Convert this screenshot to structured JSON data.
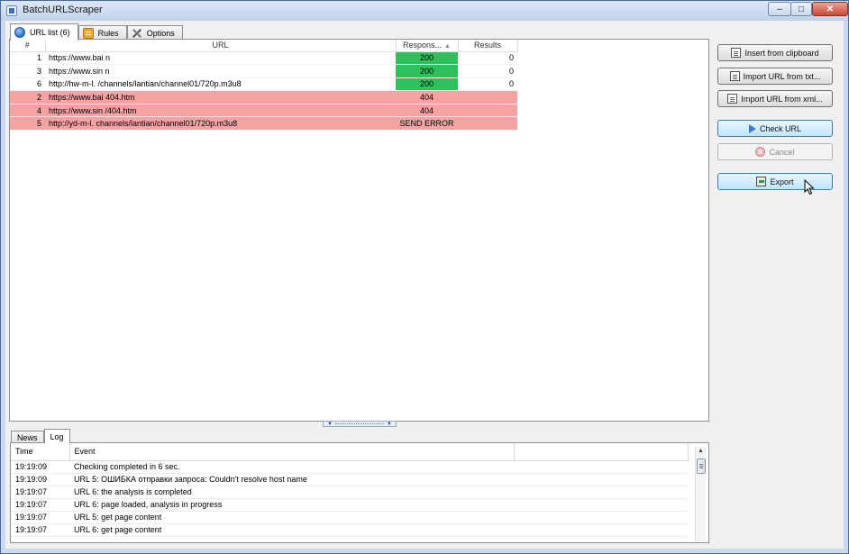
{
  "window": {
    "title": "BatchURLScraper"
  },
  "tabs_top": [
    {
      "label": "URL list (6)",
      "icon": "globe-icon",
      "active": true
    },
    {
      "label": "Rules",
      "icon": "rules-icon",
      "active": false
    },
    {
      "label": "Options",
      "icon": "tools-icon",
      "active": false
    }
  ],
  "url_table": {
    "columns": {
      "num": "#",
      "url": "URL",
      "response": "Respons...",
      "results": "Results"
    },
    "rows": [
      {
        "num": "1",
        "url": "https://www.bai          n",
        "response": "200",
        "results": "0",
        "status": "ok"
      },
      {
        "num": "3",
        "url": "https://www.sin          n",
        "response": "200",
        "results": "0",
        "status": "ok"
      },
      {
        "num": "6",
        "url": "http://hw-m-l.          /channels/lantian/channel01/720p.m3u8",
        "response": "200",
        "results": "0",
        "status": "ok"
      },
      {
        "num": "2",
        "url": "https://www.bai          404.htm",
        "response": "404",
        "results": "",
        "status": "err"
      },
      {
        "num": "4",
        "url": "https://www.sin          /404.htm",
        "response": "404",
        "results": "",
        "status": "err"
      },
      {
        "num": "5",
        "url": "http://yd-m-l.          channels/lantian/channel01/720p.m3u8",
        "response": "SEND ERROR",
        "results": "",
        "status": "err"
      }
    ]
  },
  "tabs_bottom": [
    {
      "label": "News",
      "active": false
    },
    {
      "label": "Log",
      "active": true
    }
  ],
  "log_table": {
    "columns": {
      "time": "Time",
      "event": "Event"
    },
    "rows": [
      {
        "time": "19:19:09",
        "event": "Checking completed in 6 sec."
      },
      {
        "time": "19:19:09",
        "event": "URL 5: ОШИБКА отправки запроса: Couldn't resolve host name"
      },
      {
        "time": "19:19:07",
        "event": "URL 6: the analysis is completed"
      },
      {
        "time": "19:19:07",
        "event": "URL 6: page loaded, analysis in progress"
      },
      {
        "time": "19:19:07",
        "event": "URL 5: get page content"
      },
      {
        "time": "19:19:07",
        "event": "URL 6: get page content"
      }
    ]
  },
  "side_buttons": {
    "insert_clipboard": "Insert from clipboard",
    "import_txt": "Import URL from txt...",
    "import_xml": "Import URL from xml...",
    "check_url": "Check URL",
    "cancel": "Cancel",
    "export": "Export"
  },
  "colors": {
    "ok": "#2ec05b",
    "error_row": "#f4a2a2",
    "accent_blue": "#3c7fb1"
  }
}
